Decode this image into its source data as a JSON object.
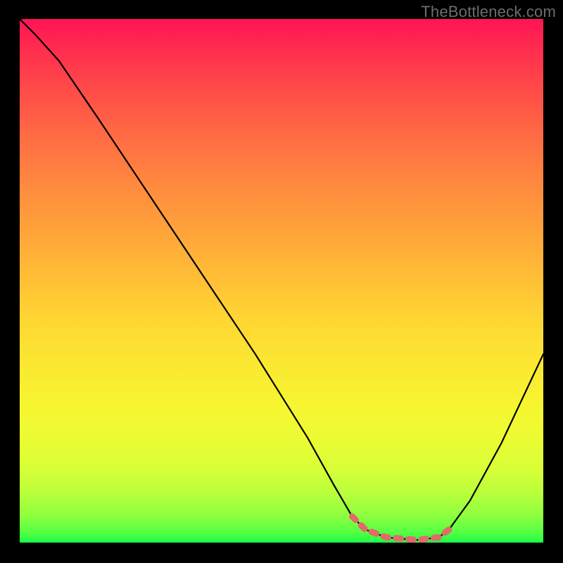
{
  "watermark": "TheBottleneck.com",
  "chart_data": {
    "type": "line",
    "title": "",
    "xlabel": "",
    "ylabel": "",
    "xlim": [
      0,
      1
    ],
    "ylim": [
      0,
      1
    ],
    "series": [
      {
        "name": "curve",
        "color": "#000000",
        "x": [
          0.0,
          0.03,
          0.075,
          0.15,
          0.25,
          0.35,
          0.45,
          0.55,
          0.6,
          0.635,
          0.66,
          0.7,
          0.76,
          0.8,
          0.82,
          0.86,
          0.92,
          1.0
        ],
        "y": [
          1.0,
          0.97,
          0.92,
          0.81,
          0.66,
          0.51,
          0.36,
          0.2,
          0.11,
          0.05,
          0.025,
          0.01,
          0.005,
          0.01,
          0.025,
          0.08,
          0.19,
          0.36
        ]
      },
      {
        "name": "flat-bottom-highlight",
        "color": "#e26a6a",
        "x": [
          0.635,
          0.66,
          0.7,
          0.76,
          0.8,
          0.82
        ],
        "y": [
          0.05,
          0.025,
          0.01,
          0.005,
          0.01,
          0.025
        ]
      }
    ],
    "gradient_stops": [
      {
        "pos": 0.0,
        "color": "#ff1454"
      },
      {
        "pos": 0.5,
        "color": "#ffc935"
      },
      {
        "pos": 0.8,
        "color": "#f3f931"
      },
      {
        "pos": 1.0,
        "color": "#1aff46"
      }
    ]
  }
}
